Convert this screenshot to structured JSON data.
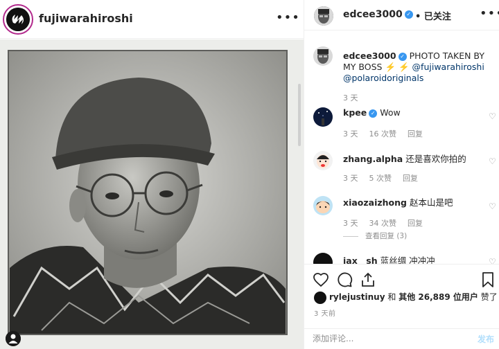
{
  "post_author": {
    "username": "fujiwarahiroshi"
  },
  "header": {
    "username": "edcee3000",
    "follow_status": "已关注",
    "more_glyph": "•••"
  },
  "caption": {
    "username": "edcee3000",
    "text": "PHOTO TAKEN BY MY BOSS",
    "emoji": "⚡️ ⚡️",
    "mention1": "@fujiwarahiroshi",
    "mention2": "@polaroidoriginals",
    "time": "3 天"
  },
  "comments": [
    {
      "username": "kpee",
      "verified": true,
      "text": "Wow",
      "time": "3 天",
      "likes": "16 次赞",
      "reply": "回复"
    },
    {
      "username": "zhang.alpha",
      "text": "还是喜欢你拍的",
      "time": "3 天",
      "likes": "5 次赞",
      "reply": "回复"
    },
    {
      "username": "xiaozaizhong",
      "text": "赵本山是吧",
      "time": "3 天",
      "likes": "34 次赞",
      "reply": "回复",
      "view_replies": "查看回复 (3)"
    },
    {
      "username": "jax__sh",
      "text": "蓝丝绸 冲冲冲"
    }
  ],
  "likes": {
    "username": "rylejustinuy",
    "connector": "和",
    "others_label": "其他 26,889 位用户",
    "suffix": "赞了"
  },
  "post_time": "3 天前",
  "comment_box": {
    "placeholder": "添加评论...",
    "post_label": "发布"
  },
  "icons": {
    "heart": "heart-icon",
    "comment": "comment-icon",
    "share": "share-icon",
    "bookmark": "bookmark-icon",
    "verified": "verified-badge-icon"
  },
  "colors": {
    "verified_blue": "#3897f0",
    "link_blue": "#003569",
    "post_disabled": "#b2dffc",
    "meta_gray": "#8e8e8e"
  }
}
